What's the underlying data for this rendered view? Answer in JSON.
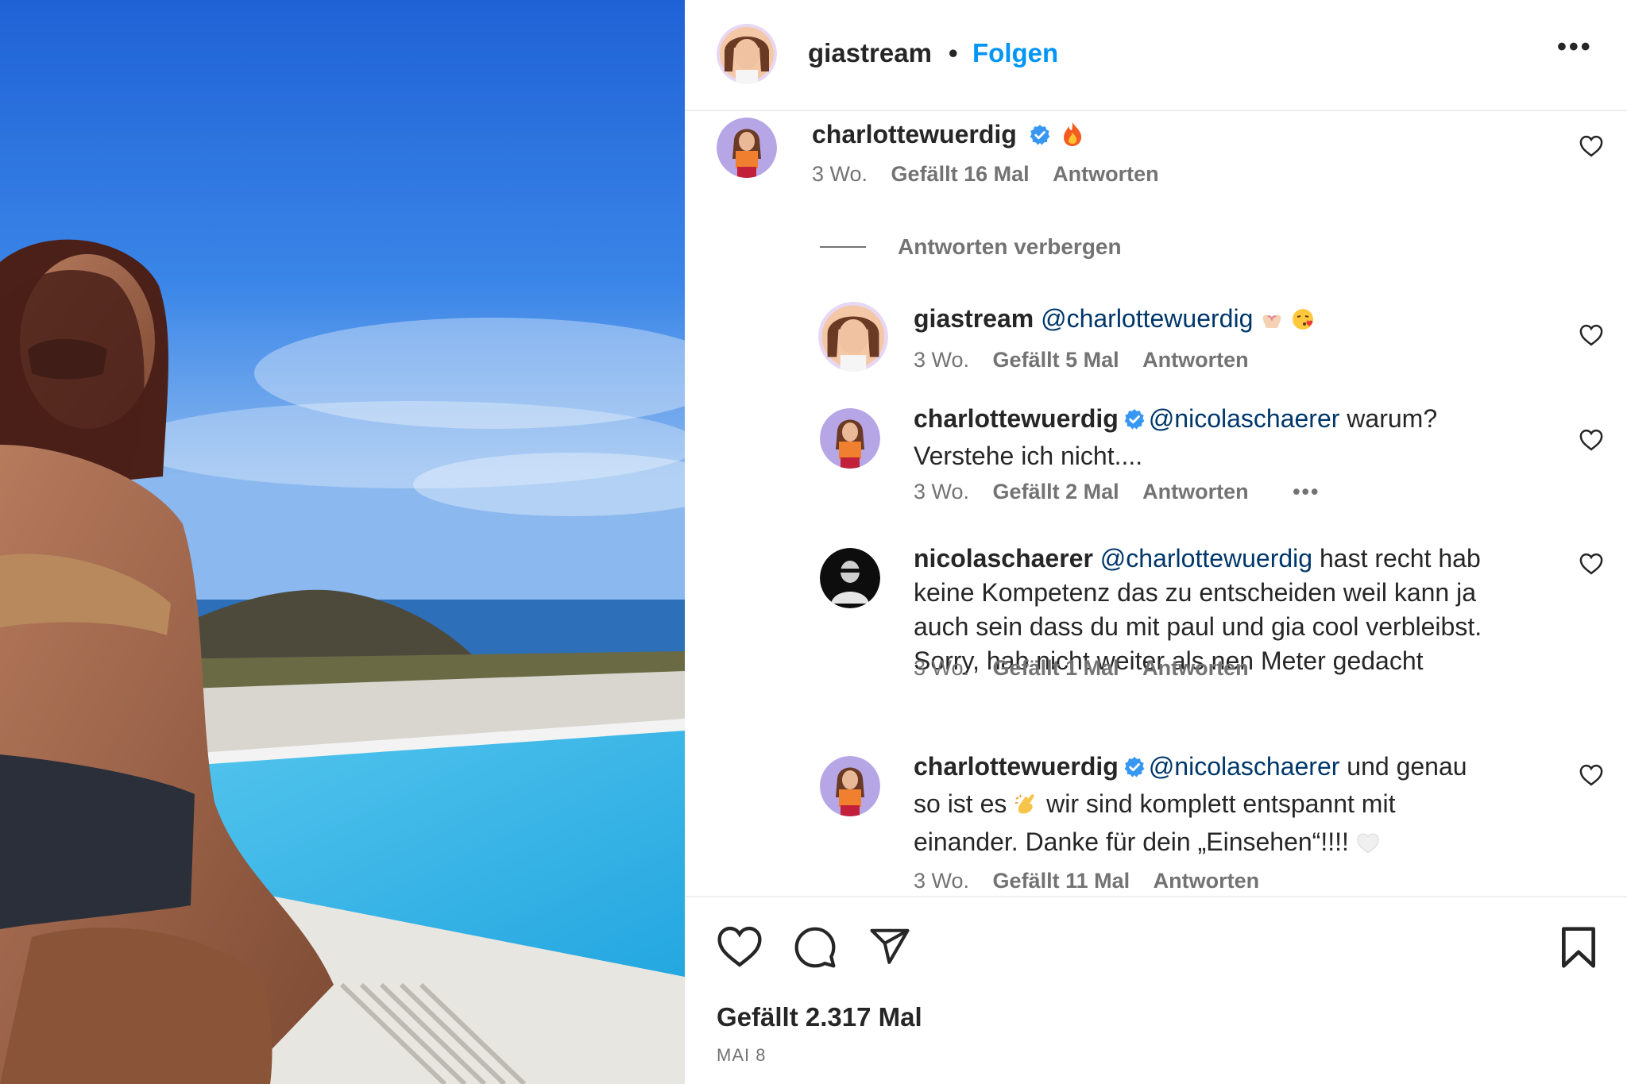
{
  "post": {
    "owner": "giastream",
    "separator": "•",
    "follow_label": "Folgen",
    "more_label": "•••",
    "likes_text": "Gefällt 2.317 Mal",
    "date_text": "MAI 8"
  },
  "colors": {
    "link_blue": "#0095f6",
    "mention_blue": "#00376b",
    "meta_gray": "#737373",
    "verified_blue": "#3897f0"
  },
  "comments": {
    "top": {
      "user": "charlottewuerdig",
      "verified": true,
      "emoji": "fire",
      "time": "3 Wo.",
      "likes": "Gefällt 16 Mal",
      "reply": "Antworten"
    },
    "hide_replies_label": "Antworten verbergen",
    "replies": [
      {
        "user": "giastream",
        "mention": "@charlottewuerdig",
        "text": "",
        "emoji": "heart-hands kiss-face",
        "time": "3 Wo.",
        "likes": "Gefällt 5 Mal",
        "reply": "Antworten"
      },
      {
        "user": "charlottewuerdig",
        "verified": true,
        "mention": "@nicolaschaerer",
        "text_line1": " warum?",
        "text_line2": "Verstehe ich nicht....",
        "time": "3 Wo.",
        "likes": "Gefällt 2 Mal",
        "reply": "Antworten",
        "more": "•••"
      },
      {
        "user": "nicolaschaerer",
        "mention": "@charlottewuerdig",
        "text_line1": " hast recht hab",
        "text_line2": "keine Kompetenz das zu entscheiden weil kann ja",
        "text_line3": "auch sein dass du mit paul und gia cool verbleibst.",
        "text_line4": "Sorry, hab nicht weiter als nen Meter gedacht",
        "time": "3 Wo.",
        "likes": "Gefällt 1 Mal",
        "reply": "Antworten"
      },
      {
        "user": "charlottewuerdig",
        "verified": true,
        "mention": "@nicolaschaerer",
        "text_line1": " und genau",
        "text_line2a": "so ist es ",
        "text_line2b": " wir sind komplett entspannt mit",
        "text_line3": "einander. Danke für dein „Einsehen“!!!! ",
        "emoji": "clapping-hands white-heart",
        "time": "3 Wo.",
        "likes": "Gefällt 11 Mal",
        "reply": "Antworten"
      }
    ]
  },
  "icons": [
    "heart-icon",
    "comment-icon",
    "share-icon",
    "bookmark-icon",
    "verified-badge-icon",
    "more-icon"
  ]
}
